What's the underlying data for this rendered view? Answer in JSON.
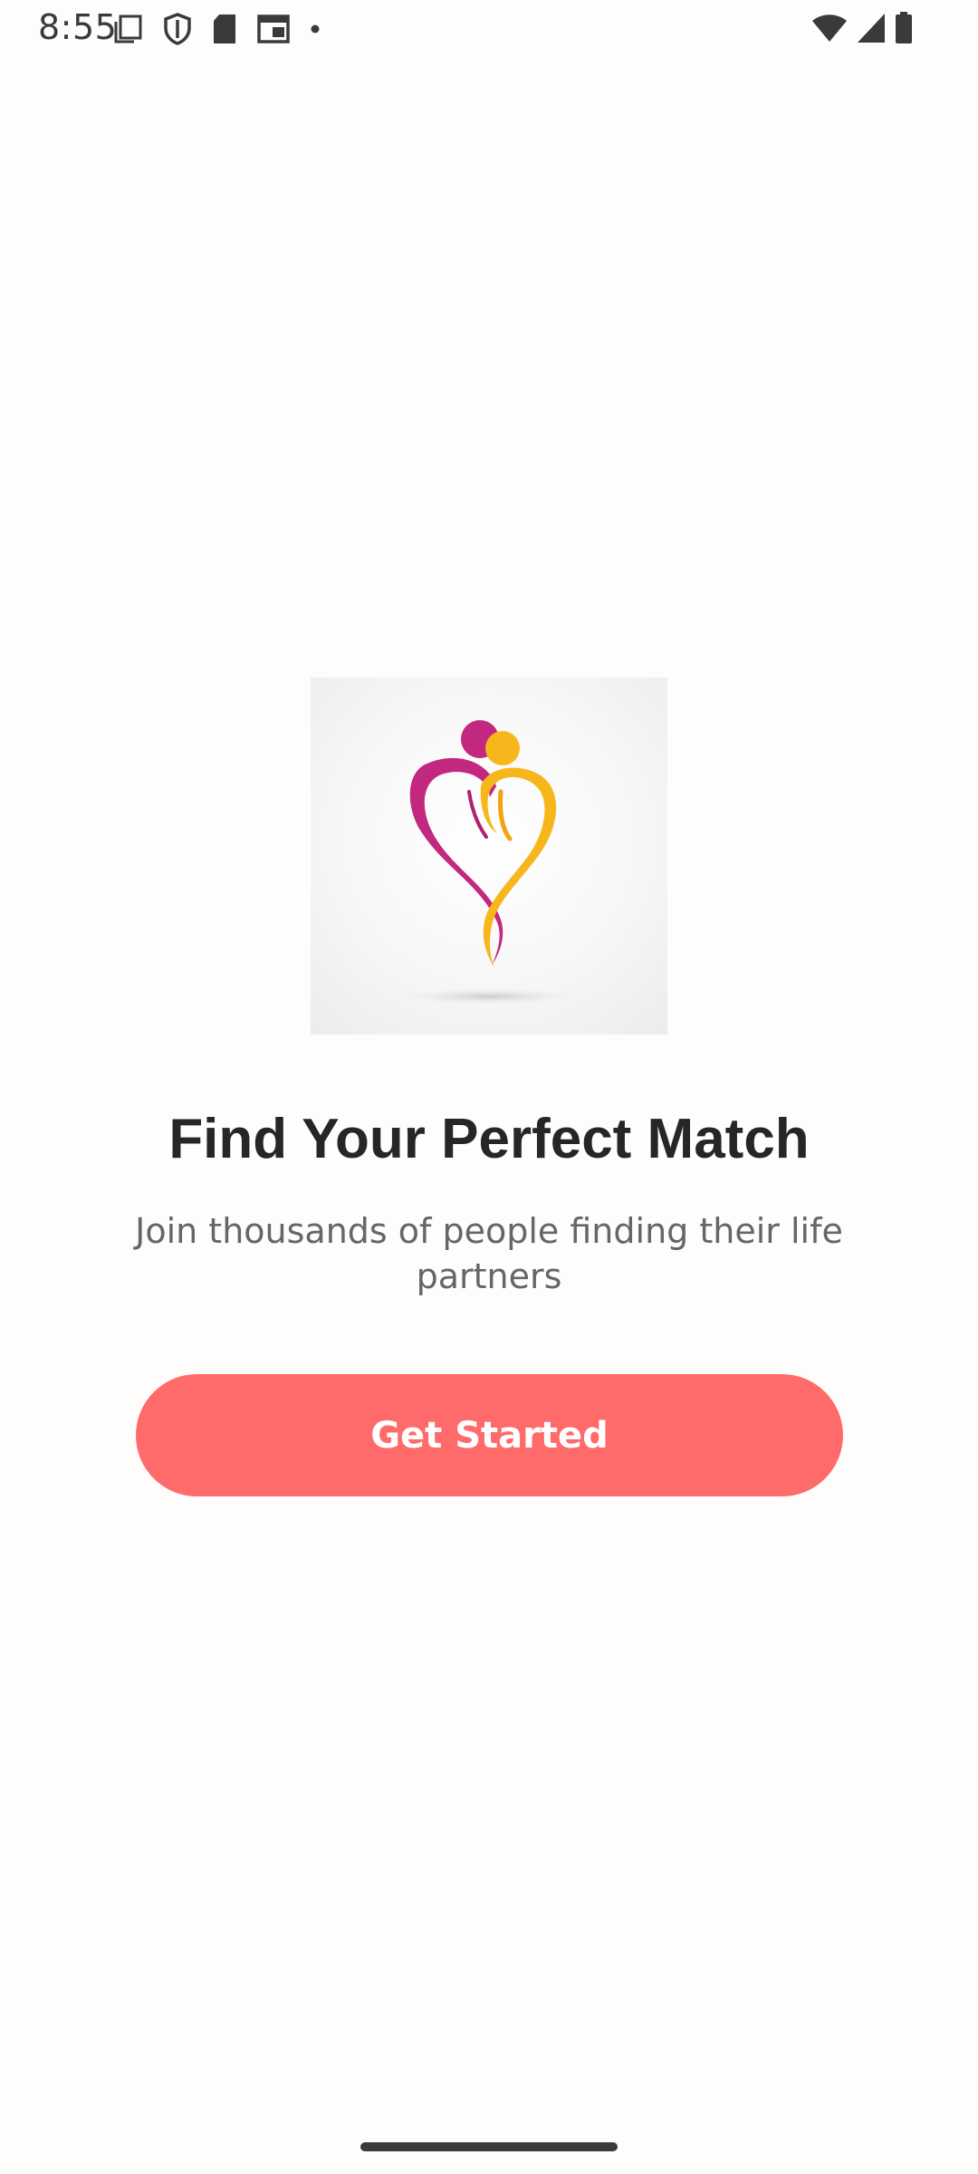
{
  "status_bar": {
    "time": "8:55",
    "left_icons": [
      "screenshot-icon",
      "shield-icon",
      "sd-card-icon",
      "calendar-icon",
      "dot-icon"
    ],
    "right_icons": [
      "wifi-icon",
      "signal-icon",
      "battery-icon"
    ]
  },
  "logo": {
    "icon": "heart-couple-logo",
    "colors": {
      "magenta": "#c2287f",
      "yellow": "#f7b61b"
    }
  },
  "main": {
    "title": "Find Your Perfect Match",
    "subtitle": "Join thousands of people finding their life partners"
  },
  "cta": {
    "label": "Get Started",
    "color": "#ff6b6b"
  }
}
